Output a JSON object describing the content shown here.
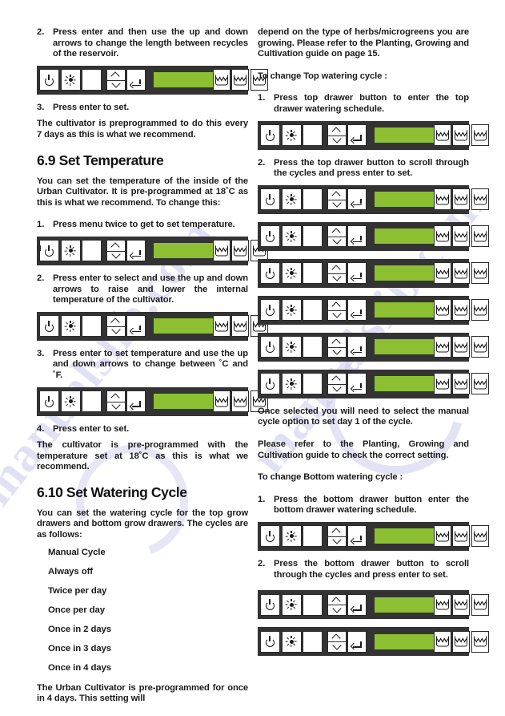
{
  "document": {
    "watermark_text": "manualslib.com"
  },
  "left_column": {
    "step_2_recycle": {
      "number": "2.",
      "text": "Press enter and then use the up and down arrows to change the length between recycles of the reservoir."
    },
    "step_3_enter_to_set": {
      "number": "3.",
      "text": "Press enter to set."
    },
    "reservoir_note": "The cultivator is preprogrammed to do this every 7 days as this is what we recommend.",
    "heading_temperature": "6.9 Set Temperature",
    "temperature_intro": "You can set the temperature of the inside of the Urban Cultivator. It is pre-programmed at 18˚C as this is what we recommend. To change this:",
    "temp_step_1": {
      "number": "1.",
      "text": "Press menu twice to get to set temperature."
    },
    "temp_step_2": {
      "number": "2.",
      "text": "Press enter to select and use the up and down arrows to raise and lower the internal temperature of the cultivator."
    },
    "temp_step_3": {
      "number": "3.",
      "text": "Press enter to set temperature and use the up and down arrows to change between ˚C and ˚F."
    },
    "temp_step_4": {
      "number": "4.",
      "text": "Press enter to set."
    },
    "temperature_note": "The cultivator is pre-programmed with the temperature set at 18˚C  as this is what we recommend.",
    "heading_watering": "6.10 Set Watering Cycle",
    "watering_intro": "You can set the watering cycle for the top grow drawers and bottom grow drawers. The cycles are as follows:",
    "cycles": [
      "Manual Cycle",
      "Always off",
      "Twice per day",
      "Once per day",
      "Once in 2 days",
      "Once in 3 days",
      "Once in 4 days"
    ],
    "preprogrammed_note": "The Urban Cultivator is pre-programmed for once in 4 days. This setting will"
  },
  "right_column": {
    "continuation_note": "depend on the type of herbs/microgreens you are growing. Please refer to the Planting, Growing and Cultivation guide on page 15.",
    "top_cycle_heading": "To change Top watering cycle :",
    "top_step_1": {
      "number": "1.",
      "text": "Press top drawer button to enter the top drawer watering schedule."
    },
    "top_step_2": {
      "number": "2.",
      "text": "Press the top drawer button to scroll through the cycles and press enter to set."
    },
    "manual_cycle_note": "Once selected you will need to select the manual cycle option to set day 1 of the cycle.",
    "refer_note": "Please refer to the Planting, Growing and Cultivation guide to check the correct setting.",
    "bottom_cycle_heading": "To change Bottom watering cycle :",
    "bottom_step_1": {
      "number": "1.",
      "text": "Press the bottom drawer button enter the bottom drawer watering schedule."
    },
    "bottom_step_2": {
      "number": "2.",
      "text": "Press the bottom drawer button to scroll through the cycles and press enter to set."
    }
  },
  "control_panel": {
    "icons": {
      "power": "power-icon",
      "light": "sun-icon",
      "blank": "blank-key",
      "arrows": "up-down-arrows-icon",
      "enter": "enter-key-icon",
      "display": "lcd-display",
      "drawer": "water-drawer-icon"
    },
    "colors": {
      "panel_background": "#333333",
      "key_face": "#ffffff",
      "lcd_green": "#8cbf32",
      "glyph": "#1b1b1b"
    },
    "drawer_count": 3
  }
}
